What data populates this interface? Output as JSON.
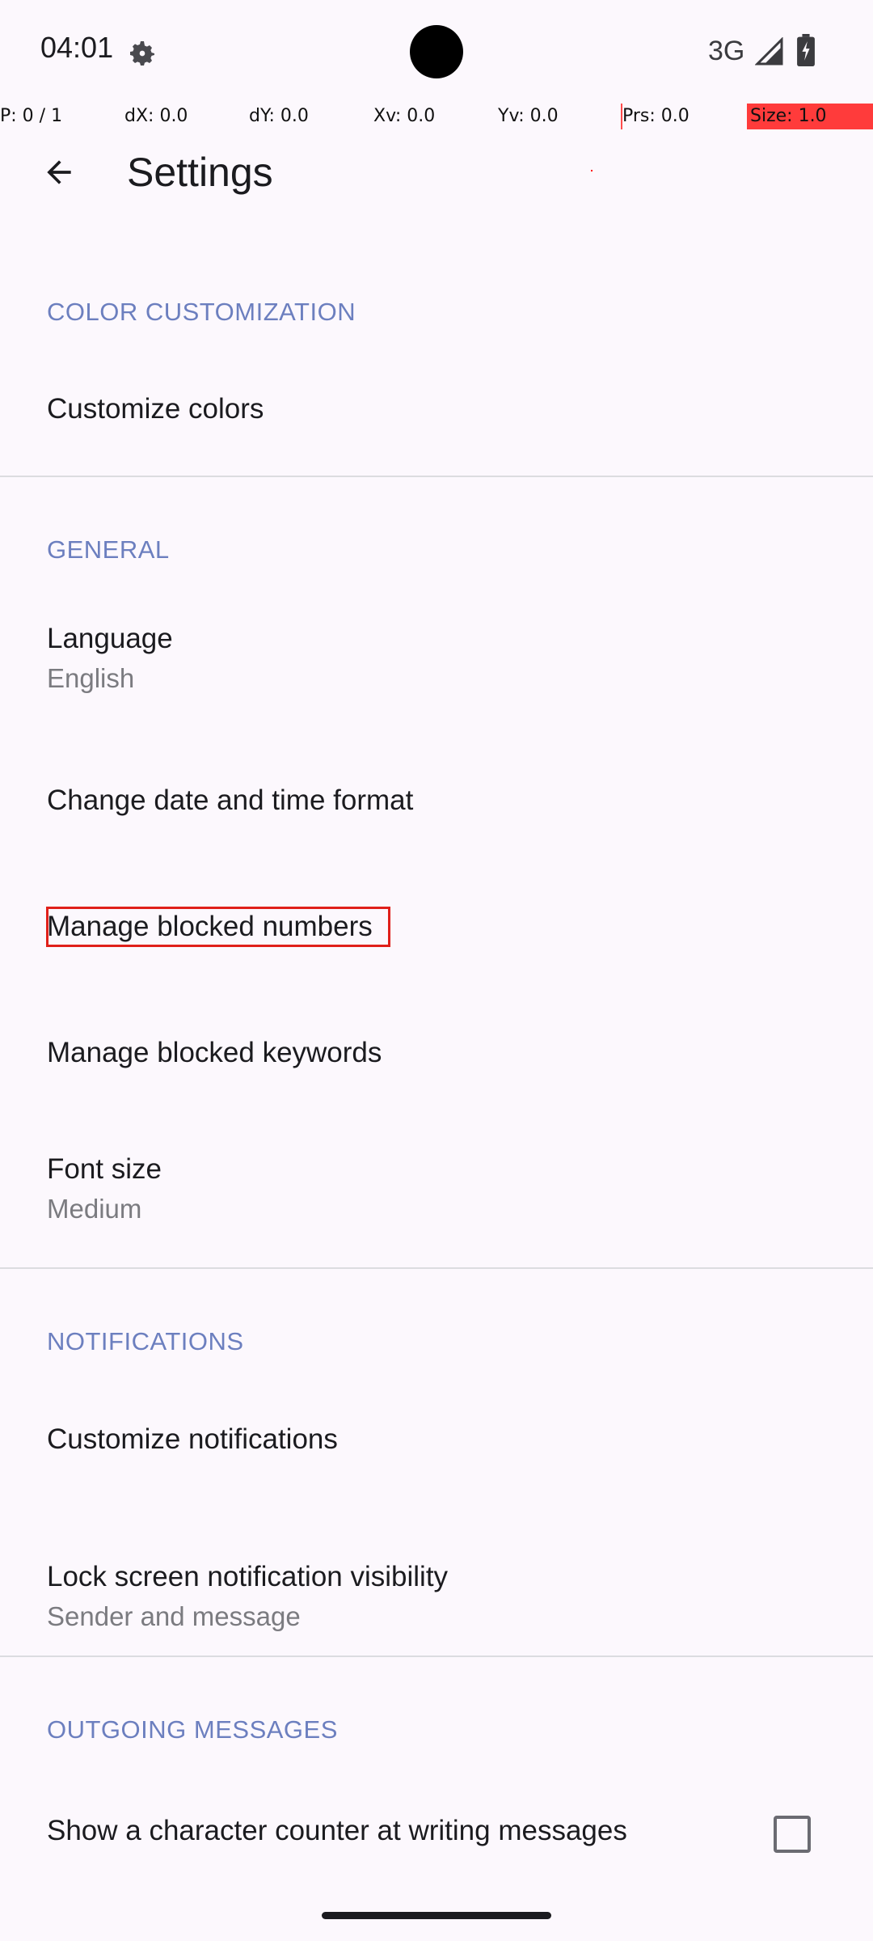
{
  "status_bar": {
    "time": "04:01",
    "network": "3G",
    "icons": [
      "settings-gear-icon",
      "signal-icon",
      "battery-icon"
    ]
  },
  "debug": {
    "p": "P: 0 / 1",
    "dx": "dX: 0.0",
    "dy": "dY: 0.0",
    "xv": "Xv: 0.0",
    "yv": "Yv: 0.0",
    "prs": "Prs: 0.0",
    "size": "Size: 1.0"
  },
  "app_bar": {
    "title": "Settings",
    "back_icon": "arrow-back-icon"
  },
  "sections": {
    "color": {
      "header": "COLOR CUSTOMIZATION",
      "customize_colors": "Customize colors"
    },
    "general": {
      "header": "GENERAL",
      "language": "Language",
      "language_value": "English",
      "date_time": "Change date and time format",
      "blocked_numbers": "Manage blocked numbers",
      "blocked_keywords": "Manage blocked keywords",
      "font_size": "Font size",
      "font_size_value": "Medium"
    },
    "notifications": {
      "header": "NOTIFICATIONS",
      "customize": "Customize notifications",
      "lock_screen": "Lock screen notification visibility",
      "lock_screen_value": "Sender and message"
    },
    "outgoing": {
      "header": "OUTGOING MESSAGES",
      "char_counter": "Show a character counter at writing messages",
      "char_counter_checked": false
    }
  },
  "colors": {
    "background": "#fcf8fd",
    "section_header": "#6c7fbf",
    "highlight": "#e0201a",
    "debug_red": "#ff3b3b"
  }
}
